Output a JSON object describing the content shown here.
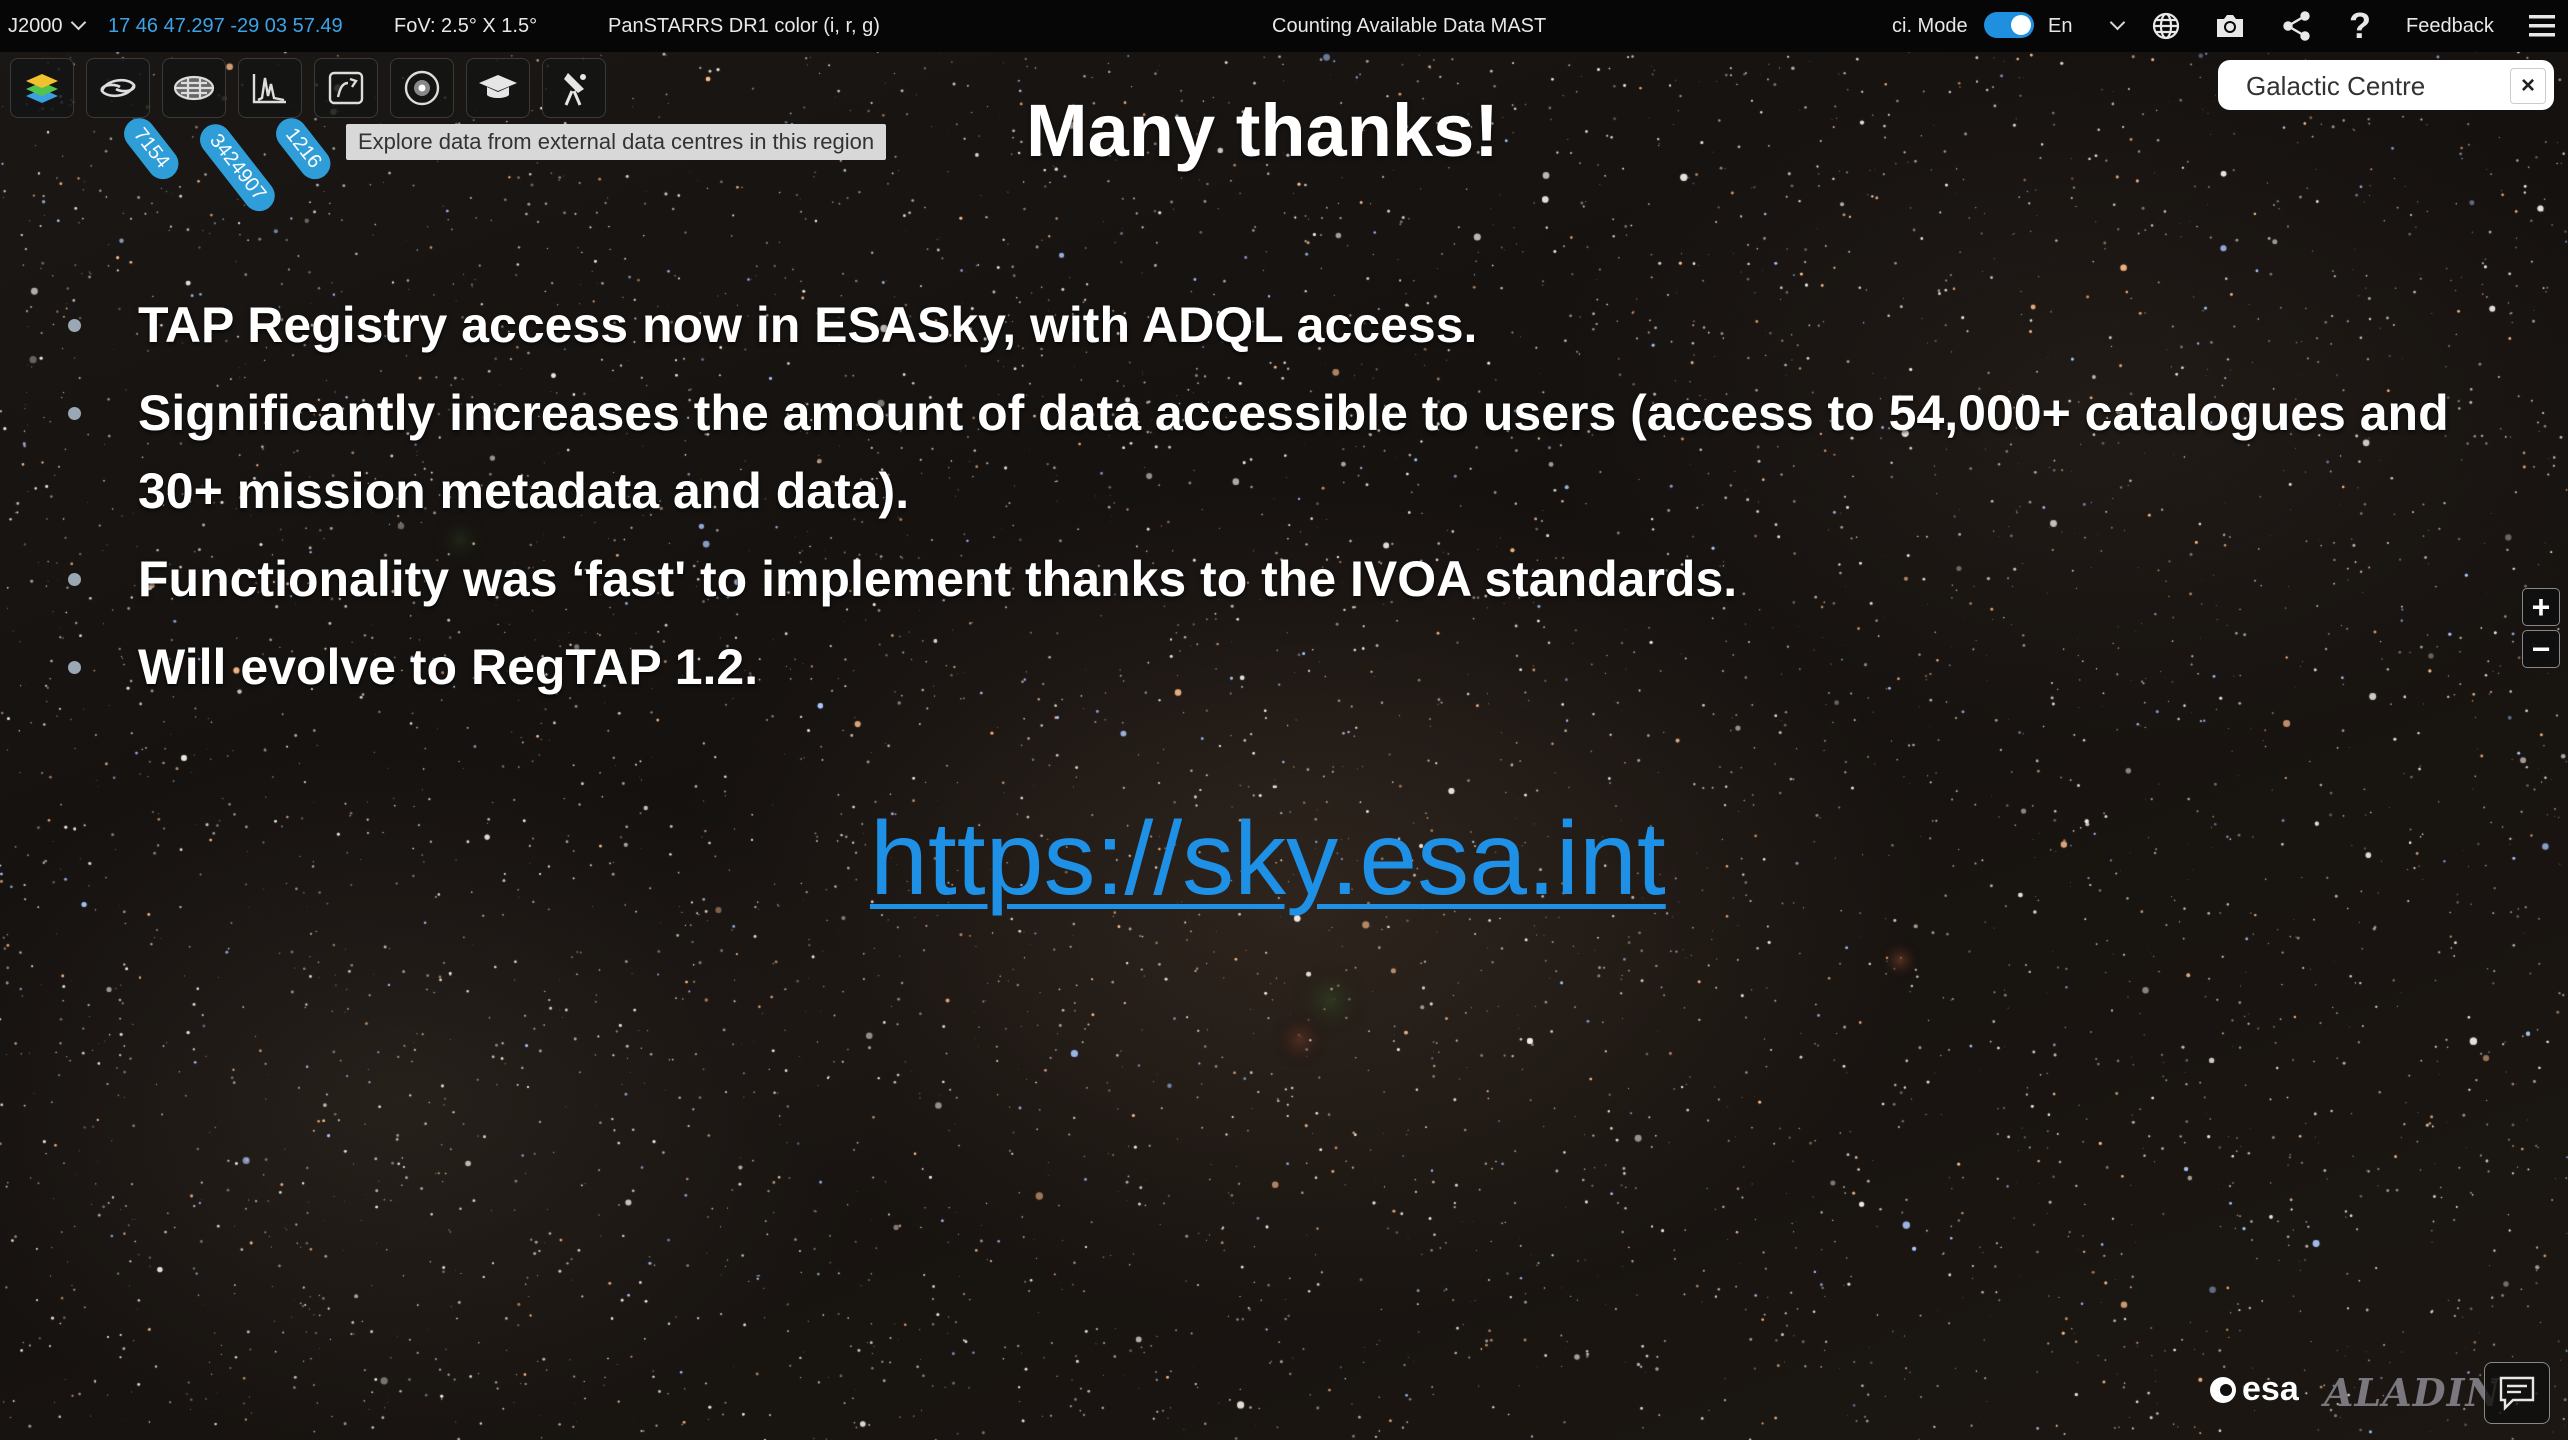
{
  "topbar": {
    "frame": "J2000",
    "coordinates": "17 46 47.297 -29 03 57.49",
    "fov": "FoV: 2.5° X 1.5°",
    "survey": "PanSTARRS DR1 color (i, r, g)",
    "status": "Counting Available Data MAST",
    "sci_mode_label": "ci. Mode",
    "sci_mode_on": true,
    "language": "En",
    "feedback": "Feedback",
    "icons": [
      "globe-icon",
      "camera-icon",
      "share-icon",
      "help-icon",
      "menu-icon"
    ]
  },
  "tools": {
    "icons": [
      "layers-icon",
      "galaxy-icon",
      "catalogue-icon",
      "spectra-icon",
      "external-data-icon",
      "planning-icon",
      "outreach-icon",
      "telescope-icon"
    ],
    "badges": [
      "7154",
      "3424907",
      "1216"
    ],
    "tooltip": "Explore data from external data centres in this region"
  },
  "target": {
    "name": "Galactic Centre",
    "close": "×"
  },
  "slide": {
    "title": "Many thanks!",
    "bullets": [
      "TAP Registry access now in ESASky, with ADQL access.",
      "Significantly increases the amount of data accessible to users (access to 54,000+ catalogues and 30+ mission metadata and data).",
      "Functionality was ‘fast' to implement thanks to the IVOA standards.",
      "Will evolve to RegTAP 1.2."
    ],
    "link": "https://sky.esa.int"
  },
  "zoom": {
    "in": "+",
    "out": "−"
  },
  "footer": {
    "esa_logo": "esa",
    "aladin_logo": "ALADIN",
    "chat_icon": "chat-icon"
  },
  "colors": {
    "accent": "#1e90e6",
    "badge": "#2f9ed8",
    "topbar": "#060606"
  }
}
